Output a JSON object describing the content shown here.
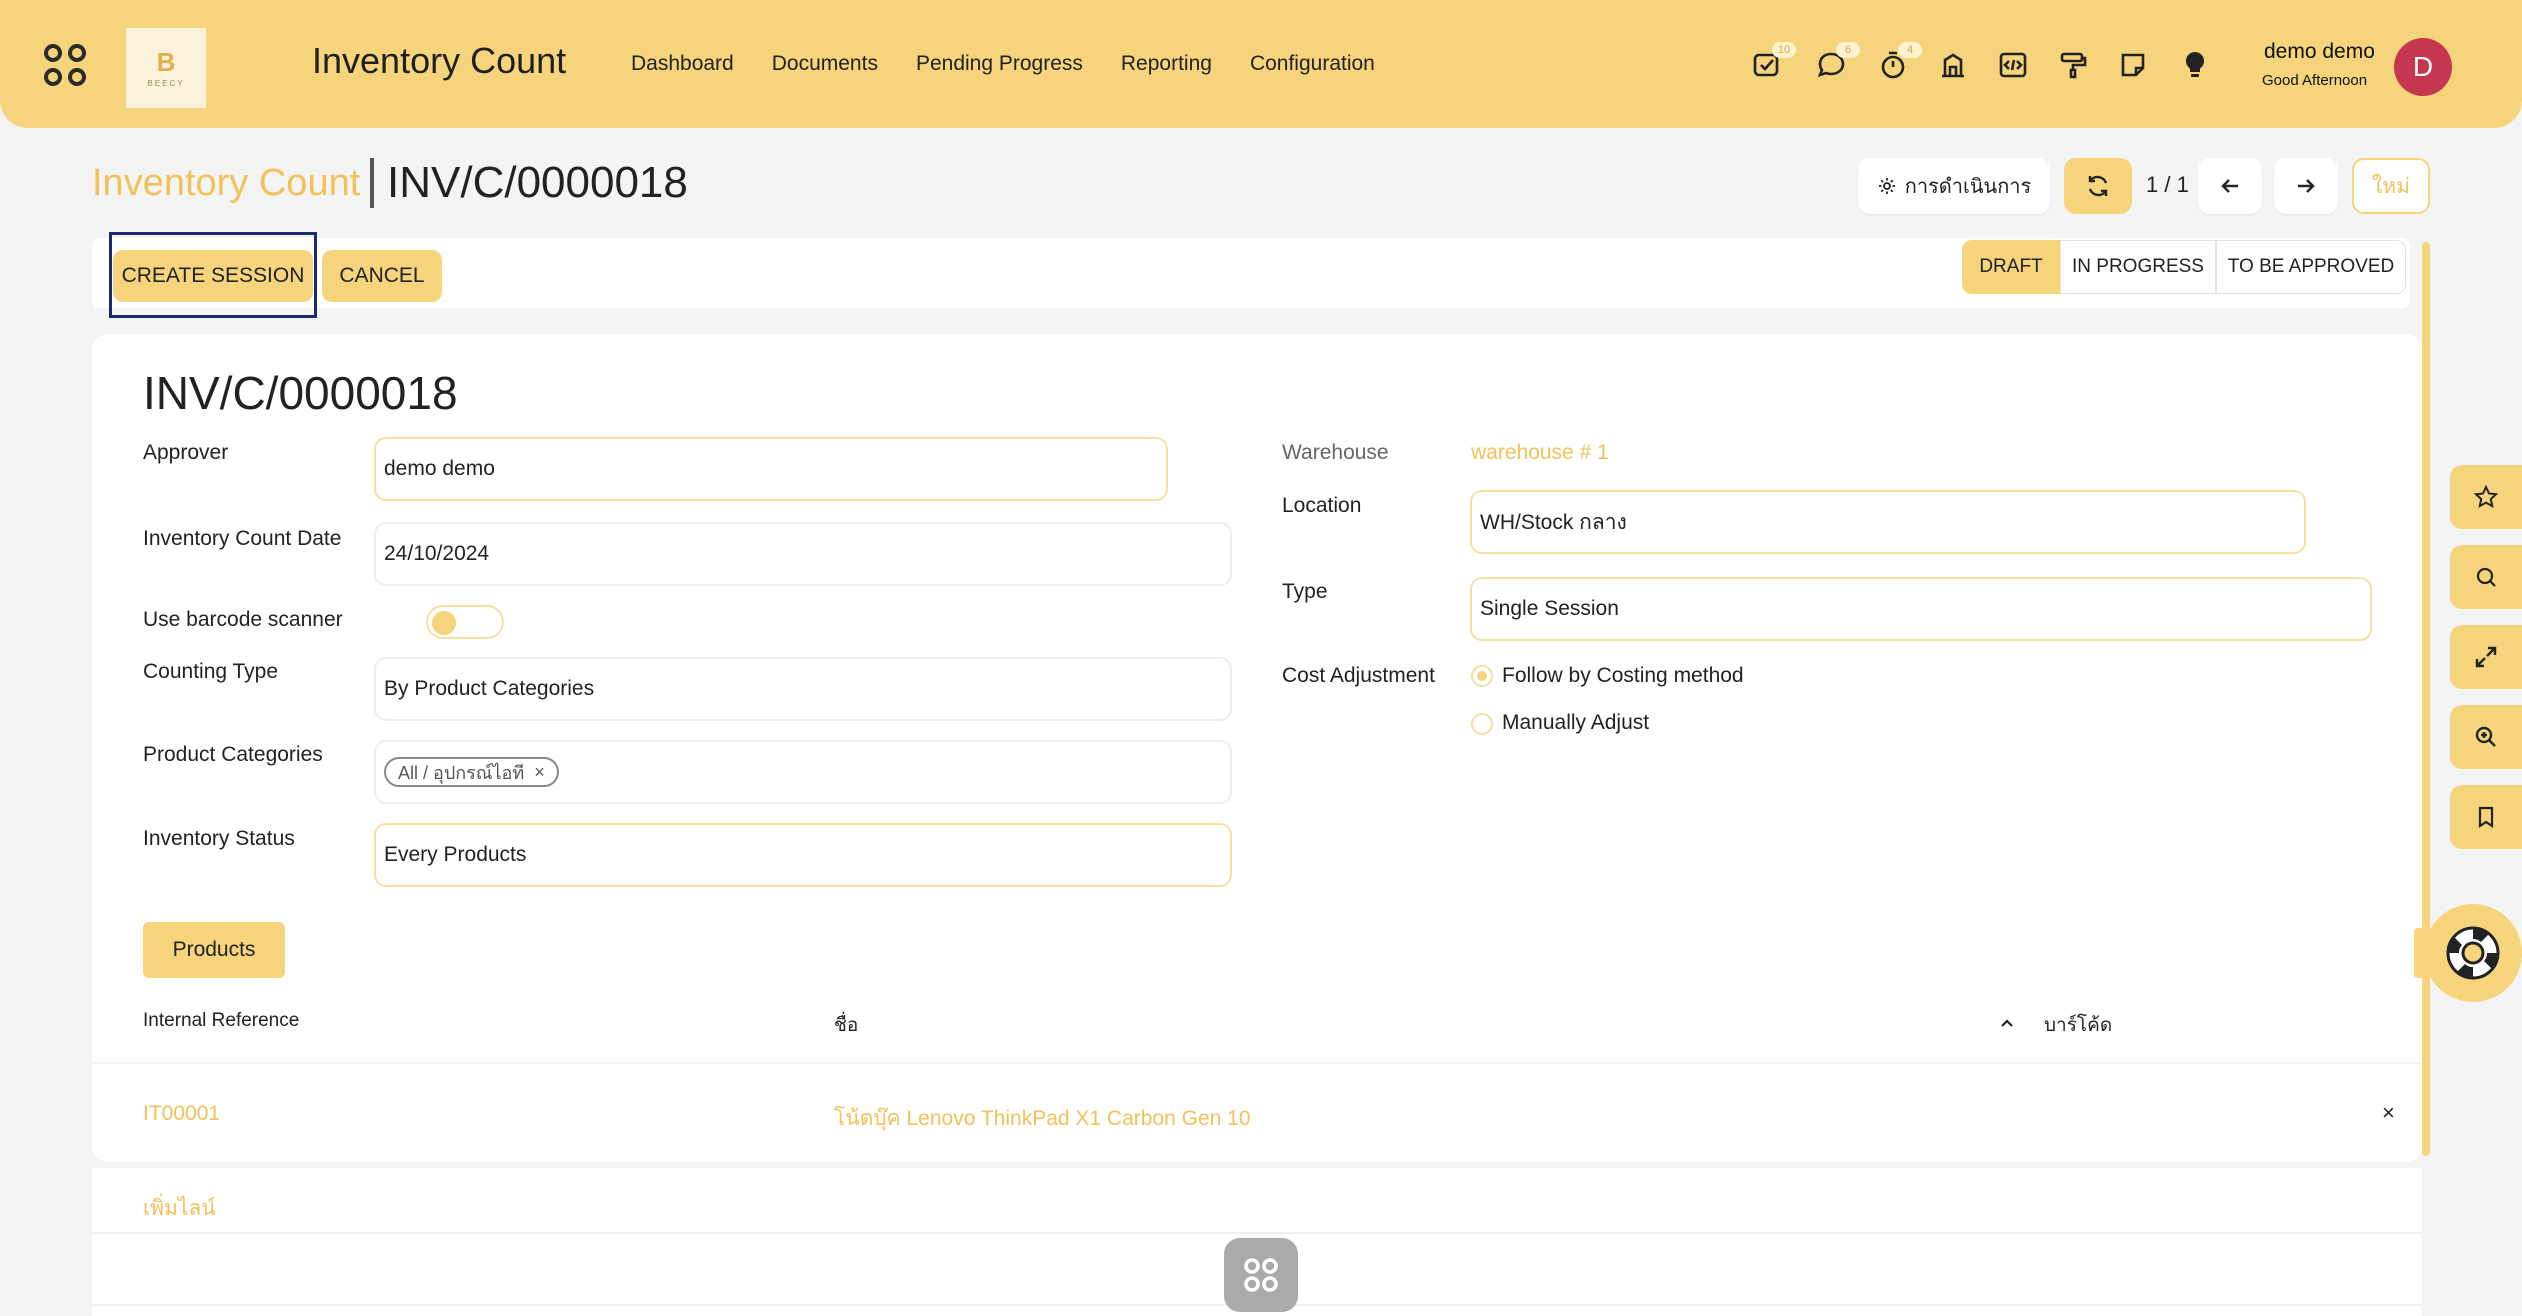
{
  "app": {
    "title": "Inventory Count",
    "logo_letter": "B",
    "logo_text": "BEECY"
  },
  "nav": {
    "items": [
      "Dashboard",
      "Documents",
      "Pending Progress",
      "Reporting",
      "Configuration"
    ]
  },
  "systray": {
    "activity_badge": "10",
    "messages_badge": "6",
    "timer_badge": "4"
  },
  "user": {
    "name": "demo demo",
    "greeting": "Good Afternoon",
    "avatar_initial": "D"
  },
  "breadcrumb": {
    "parent": "Inventory Count",
    "current": "INV/C/0000018"
  },
  "control": {
    "actions_label": "การดำเนินการ",
    "pager": "1 / 1",
    "new_label": "ใหม่"
  },
  "statusbar": {
    "create_session": "CREATE SESSION",
    "cancel": "CANCEL",
    "stages": [
      {
        "label": "DRAFT",
        "active": true
      },
      {
        "label": "IN PROGRESS",
        "active": false
      },
      {
        "label": "TO BE APPROVED",
        "active": false
      }
    ]
  },
  "form": {
    "title": "INV/C/0000018",
    "approver_label": "Approver",
    "approver_value": "demo demo",
    "count_date_label": "Inventory Count Date",
    "count_date_value": "24/10/2024",
    "barcode_label": "Use barcode scanner",
    "barcode_enabled": false,
    "counting_type_label": "Counting Type",
    "counting_type_value": "By Product Categories",
    "product_categories_label": "Product Categories",
    "product_categories_tag": "All / อุปกรณ์ไอที",
    "inventory_status_label": "Inventory Status",
    "inventory_status_value": "Every Products",
    "warehouse_label": "Warehouse",
    "warehouse_value": "warehouse # 1",
    "location_label": "Location",
    "location_value": "WH/Stock กลาง",
    "type_label": "Type",
    "type_value": "Single Session",
    "cost_adjustment_label": "Cost Adjustment",
    "cost_options": [
      {
        "label": "Follow by Costing method",
        "selected": true
      },
      {
        "label": "Manually Adjust",
        "selected": false
      }
    ]
  },
  "products": {
    "tab_label": "Products",
    "columns": [
      "Internal Reference",
      "ชื่อ",
      "บาร์โค้ด"
    ],
    "rows": [
      {
        "internal_ref": "IT00001",
        "name": "โน้ตบุ๊ค Lenovo ThinkPad X1 Carbon Gen 10",
        "barcode": ""
      }
    ],
    "add_line": "เพิ่มไลน์"
  },
  "colors": {
    "accent": "#f6d47c",
    "accent_text": "#f2c15a",
    "avatar": "#c5364f"
  }
}
